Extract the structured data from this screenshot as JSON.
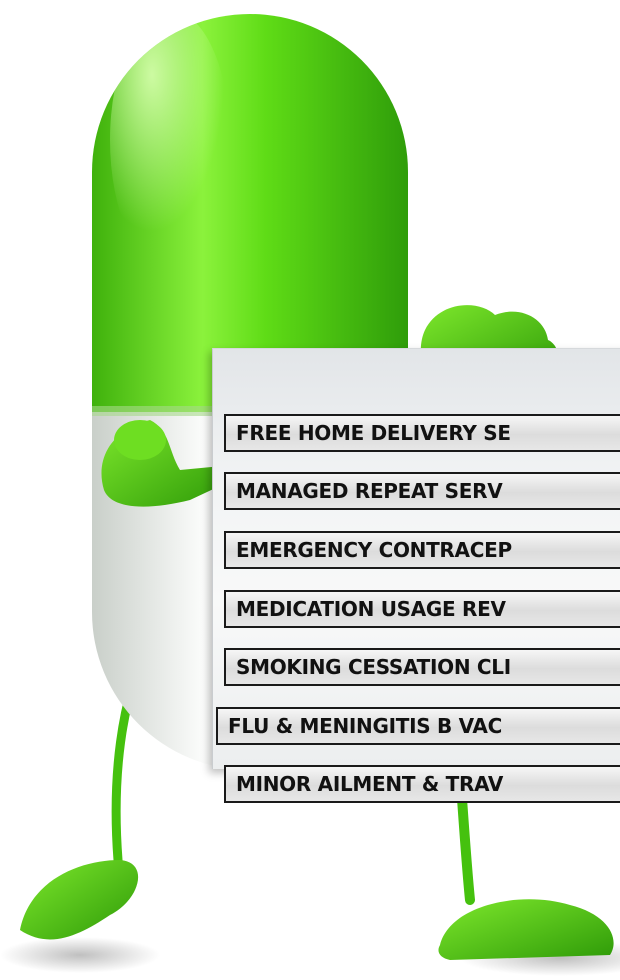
{
  "services": [
    {
      "label": "FREE HOME DELIVERY SE"
    },
    {
      "label": "MANAGED REPEAT SERV"
    },
    {
      "label": "EMERGENCY CONTRACEP"
    },
    {
      "label": "MEDICATION USAGE REV"
    },
    {
      "label": "SMOKING CESSATION CLI"
    },
    {
      "label": "FLU & MENINGITIS B VAC"
    },
    {
      "label": "MINOR AILMENT & TRAV"
    }
  ],
  "colors": {
    "pill_green": "#5fdc16",
    "pill_green_dark": "#2f9d0a",
    "pill_white": "#f2f4f2",
    "sign_border": "#1a1a1a"
  }
}
